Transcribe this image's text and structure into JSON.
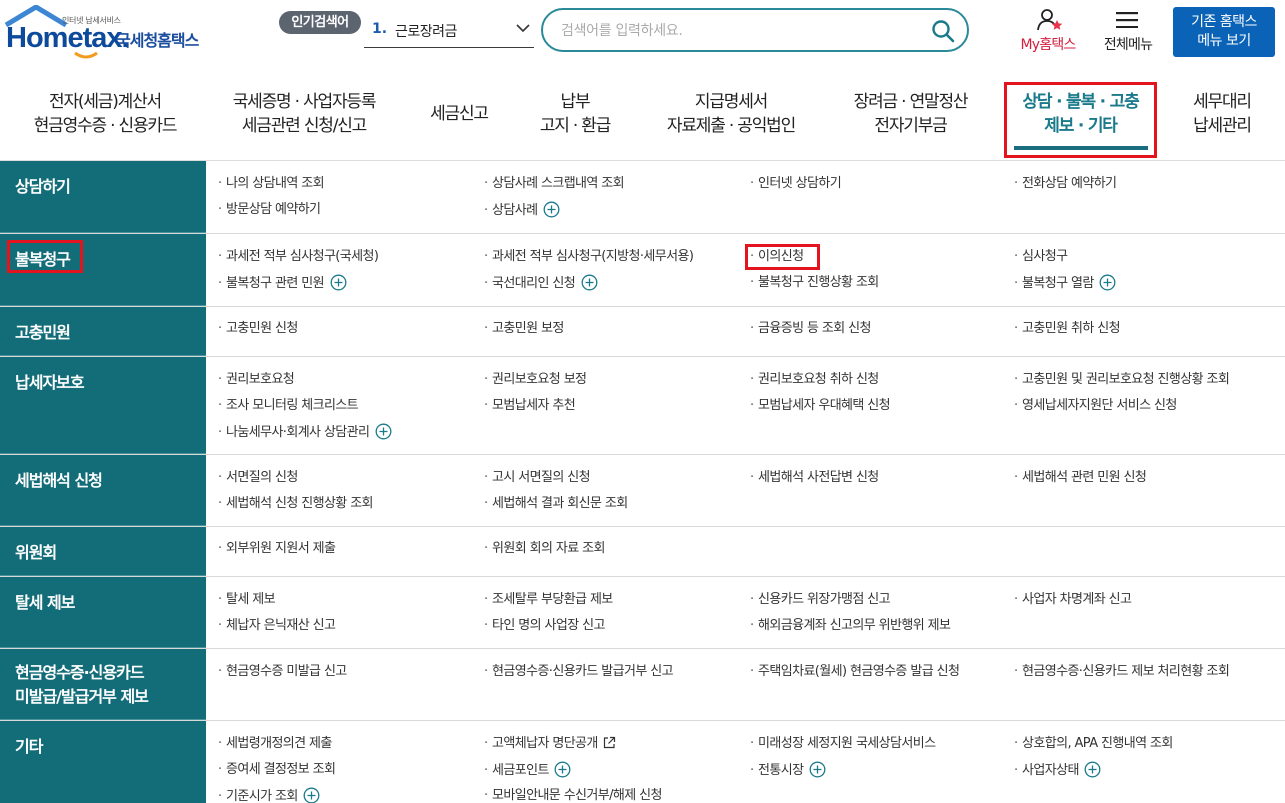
{
  "header": {
    "logo_tagline": "인터넷 납세서비스",
    "logo_main": "Hometax.",
    "logo_sub": "국세청홈택스",
    "popular_label": "인기검색어",
    "popular_rank": "1.",
    "popular_term": "근로장려금",
    "search_placeholder": "검색어를 입력하세요.",
    "my_hometax": "My홈택스",
    "all_menu": "전체메뉴",
    "legacy_line1": "기존 홈택스",
    "legacy_line2": "메뉴 보기"
  },
  "gnb": [
    {
      "l1": "전자(세금)계산서",
      "l2": "현금영수증 · 신용카드"
    },
    {
      "l1": "국세증명 · 사업자등록",
      "l2": "세금관련 신청/신고"
    },
    {
      "l1": "세금신고",
      "l2": ""
    },
    {
      "l1": "납부",
      "l2": "고지 · 환급"
    },
    {
      "l1": "지급명세서",
      "l2": "자료제출 · 공익법인"
    },
    {
      "l1": "장려금 · 연말정산",
      "l2": "전자기부금"
    },
    {
      "l1": "상담 · 불복 · 고충",
      "l2": "제보 · 기타"
    },
    {
      "l1": "세무대리",
      "l2": "납세관리"
    }
  ],
  "menu": {
    "consult": {
      "head": "상담하기",
      "items": [
        "나의 상담내역 조회",
        "상담사례 스크랩내역 조회",
        "인터넷 상담하기",
        "전화상담 예약하기",
        "방문상담 예약하기",
        "상담사례"
      ]
    },
    "appeal": {
      "head": "불복청구",
      "items": [
        "과세전 적부 심사청구(국세청)",
        "과세전 적부 심사청구(지방청·세무서용)",
        "이의신청",
        "심사청구",
        "불복청구 관련 민원",
        "국선대리인 신청",
        "불복청구 진행상황 조회",
        "불복청구 열람"
      ]
    },
    "grievance": {
      "head": "고충민원",
      "items": [
        "고충민원 신청",
        "고충민원 보정",
        "금융증빙 등 조회 신청",
        "고충민원 취하 신청"
      ]
    },
    "protection": {
      "head": "납세자보호",
      "items": [
        "권리보호요청",
        "권리보호요청 보정",
        "권리보호요청 취하 신청",
        "고충민원 및 권리보호요청 진행상황 조회",
        "조사 모니터링 체크리스트",
        "모범납세자 추천",
        "모범납세자 우대혜택 신청",
        "영세납세자지원단 서비스 신청",
        "나눔세무사·회계사 상담관리"
      ]
    },
    "interpretation": {
      "head": "세법해석 신청",
      "items": [
        "서면질의 신청",
        "고시 서면질의 신청",
        "세법해석 사전답변 신청",
        "세법해석 관련 민원 신청",
        "세법해석 신청 진행상황 조회",
        "세법해석 결과 회신문 조회"
      ]
    },
    "committee": {
      "head": "위원회",
      "items": [
        "외부위원 지원서 제출",
        "위원회 회의 자료 조회"
      ]
    },
    "report": {
      "head": "탈세 제보",
      "items": [
        "탈세 제보",
        "조세탈루 부당환급 제보",
        "신용카드 위장가맹점 신고",
        "사업자 차명계좌 신고",
        "체납자 은닉재산 신고",
        "타인 명의 사업장 신고",
        "해외금융계좌 신고의무 위반행위 제보"
      ]
    },
    "receipt": {
      "head1": "현금영수증·신용카드",
      "head2": "미발급/발급거부 제보",
      "items": [
        "현금영수증 미발급 신고",
        "현금영수증·신용카드 발급거부 신고",
        "주택임차료(월세) 현금영수증 발급 신청",
        "현금영수증·신용카드 제보 처리현황 조회"
      ]
    },
    "etc": {
      "head": "기타",
      "items": [
        "세법령개정의견 제출",
        "고액체납자 명단공개",
        "미래성장 세정지원 국세상담서비스",
        "상호합의, APA 진행내역 조회",
        "증여세 결정정보 조회",
        "세금포인트",
        "전통시장",
        "사업자상태",
        "기준시가 조회",
        "모바일안내문 수신거부/해제 신청"
      ]
    }
  },
  "colors": {
    "teal_head": "#136d79",
    "active_text": "#1a7a8b",
    "highlight_red": "#e4141e",
    "logo_blue": "#0d4a9c",
    "legacy_blue": "#0b63b7"
  }
}
